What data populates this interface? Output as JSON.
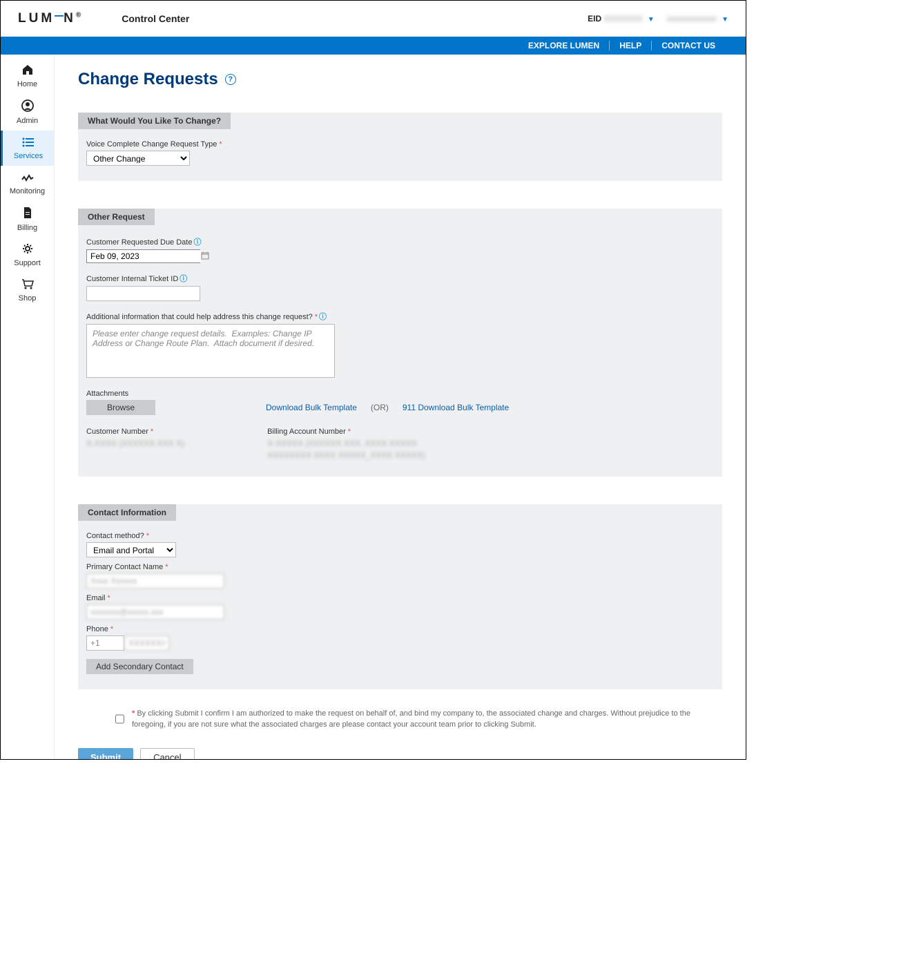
{
  "header": {
    "logo": "LUMEN",
    "app_title": "Control Center",
    "eid_label": "EID",
    "eid_value": "XXXXXXX",
    "user_value": "xxxxxxxxxxxx"
  },
  "topnav": {
    "explore": "EXPLORE LUMEN",
    "help": "HELP",
    "contact": "CONTACT US"
  },
  "sidebar": [
    {
      "icon": "⌂",
      "label": "Home"
    },
    {
      "icon": "◯",
      "label": "Admin"
    },
    {
      "icon": "≣",
      "label": "Services",
      "active": true
    },
    {
      "icon": "∿",
      "label": "Monitoring"
    },
    {
      "icon": "▤",
      "label": "Billing"
    },
    {
      "icon": "⚙",
      "label": "Support"
    },
    {
      "icon": "🛒",
      "label": "Shop"
    }
  ],
  "page": {
    "title": "Change Requests"
  },
  "section1": {
    "title": "What Would You Like To Change?",
    "type_label": "Voice Complete Change Request Type",
    "type_value": "Other Change"
  },
  "section2": {
    "title": "Other Request",
    "due_date_label": "Customer Requested Due Date",
    "due_date_value": "Feb 09, 2023",
    "ticket_label": "Customer Internal Ticket ID",
    "ticket_value": "",
    "addl_label": "Additional information that could help address this change request?",
    "addl_placeholder": "Please enter change request details.  Examples: Change IP Address or Change Route Plan.  Attach document if desired.",
    "attachments_label": "Attachments",
    "browse": "Browse",
    "dl_template": "Download Bulk Template",
    "or": "(OR)",
    "dl_911": "911 Download Bulk Template",
    "customer_number_label": "Customer Number",
    "customer_number_value": "X-XXXX (XXXXXX XXX X)",
    "ban_label": "Billing Account Number",
    "ban_value": "X-XXXXX  (XXXXXX XXX, XXXX XXXXX XXXXXXXX XXXX XXXXX_XXXX XXXXX)"
  },
  "section3": {
    "title": "Contact Information",
    "method_label": "Contact method?",
    "method_value": "Email and Portal",
    "primary_label": "Primary Contact Name",
    "primary_value": "Xxxx Xxxxxx",
    "email_label": "Email",
    "email_value": "xxxxxxx@xxxxx.xxx",
    "phone_label": "Phone",
    "phone_prefix": "+1",
    "phone_value": "XXXXXXXXX",
    "secondary_btn": "Add Secondary Contact"
  },
  "disclaimer": "By clicking Submit I confirm I am authorized to make the request on behalf of, and bind my company to, the associated change and charges. Without prejudice to the foregoing, if you are not sure what the associated charges are please contact your account team prior to clicking Submit.",
  "actions": {
    "submit": "Submit",
    "cancel": "Cancel"
  }
}
